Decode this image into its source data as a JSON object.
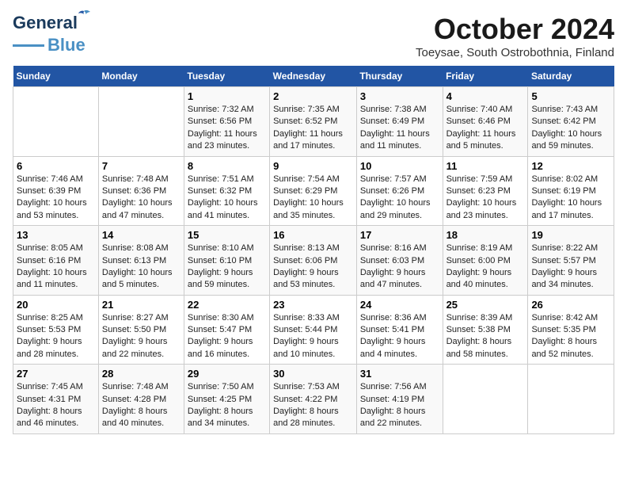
{
  "logo": {
    "line1": "General",
    "line2": "Blue"
  },
  "title": "October 2024",
  "subtitle": "Toeysae, South Ostrobothnia, Finland",
  "days_of_week": [
    "Sunday",
    "Monday",
    "Tuesday",
    "Wednesday",
    "Thursday",
    "Friday",
    "Saturday"
  ],
  "weeks": [
    [
      {
        "day": "",
        "content": ""
      },
      {
        "day": "",
        "content": ""
      },
      {
        "day": "1",
        "content": "Sunrise: 7:32 AM\nSunset: 6:56 PM\nDaylight: 11 hours\nand 23 minutes."
      },
      {
        "day": "2",
        "content": "Sunrise: 7:35 AM\nSunset: 6:52 PM\nDaylight: 11 hours\nand 17 minutes."
      },
      {
        "day": "3",
        "content": "Sunrise: 7:38 AM\nSunset: 6:49 PM\nDaylight: 11 hours\nand 11 minutes."
      },
      {
        "day": "4",
        "content": "Sunrise: 7:40 AM\nSunset: 6:46 PM\nDaylight: 11 hours\nand 5 minutes."
      },
      {
        "day": "5",
        "content": "Sunrise: 7:43 AM\nSunset: 6:42 PM\nDaylight: 10 hours\nand 59 minutes."
      }
    ],
    [
      {
        "day": "6",
        "content": "Sunrise: 7:46 AM\nSunset: 6:39 PM\nDaylight: 10 hours\nand 53 minutes."
      },
      {
        "day": "7",
        "content": "Sunrise: 7:48 AM\nSunset: 6:36 PM\nDaylight: 10 hours\nand 47 minutes."
      },
      {
        "day": "8",
        "content": "Sunrise: 7:51 AM\nSunset: 6:32 PM\nDaylight: 10 hours\nand 41 minutes."
      },
      {
        "day": "9",
        "content": "Sunrise: 7:54 AM\nSunset: 6:29 PM\nDaylight: 10 hours\nand 35 minutes."
      },
      {
        "day": "10",
        "content": "Sunrise: 7:57 AM\nSunset: 6:26 PM\nDaylight: 10 hours\nand 29 minutes."
      },
      {
        "day": "11",
        "content": "Sunrise: 7:59 AM\nSunset: 6:23 PM\nDaylight: 10 hours\nand 23 minutes."
      },
      {
        "day": "12",
        "content": "Sunrise: 8:02 AM\nSunset: 6:19 PM\nDaylight: 10 hours\nand 17 minutes."
      }
    ],
    [
      {
        "day": "13",
        "content": "Sunrise: 8:05 AM\nSunset: 6:16 PM\nDaylight: 10 hours\nand 11 minutes."
      },
      {
        "day": "14",
        "content": "Sunrise: 8:08 AM\nSunset: 6:13 PM\nDaylight: 10 hours\nand 5 minutes."
      },
      {
        "day": "15",
        "content": "Sunrise: 8:10 AM\nSunset: 6:10 PM\nDaylight: 9 hours\nand 59 minutes."
      },
      {
        "day": "16",
        "content": "Sunrise: 8:13 AM\nSunset: 6:06 PM\nDaylight: 9 hours\nand 53 minutes."
      },
      {
        "day": "17",
        "content": "Sunrise: 8:16 AM\nSunset: 6:03 PM\nDaylight: 9 hours\nand 47 minutes."
      },
      {
        "day": "18",
        "content": "Sunrise: 8:19 AM\nSunset: 6:00 PM\nDaylight: 9 hours\nand 40 minutes."
      },
      {
        "day": "19",
        "content": "Sunrise: 8:22 AM\nSunset: 5:57 PM\nDaylight: 9 hours\nand 34 minutes."
      }
    ],
    [
      {
        "day": "20",
        "content": "Sunrise: 8:25 AM\nSunset: 5:53 PM\nDaylight: 9 hours\nand 28 minutes."
      },
      {
        "day": "21",
        "content": "Sunrise: 8:27 AM\nSunset: 5:50 PM\nDaylight: 9 hours\nand 22 minutes."
      },
      {
        "day": "22",
        "content": "Sunrise: 8:30 AM\nSunset: 5:47 PM\nDaylight: 9 hours\nand 16 minutes."
      },
      {
        "day": "23",
        "content": "Sunrise: 8:33 AM\nSunset: 5:44 PM\nDaylight: 9 hours\nand 10 minutes."
      },
      {
        "day": "24",
        "content": "Sunrise: 8:36 AM\nSunset: 5:41 PM\nDaylight: 9 hours\nand 4 minutes."
      },
      {
        "day": "25",
        "content": "Sunrise: 8:39 AM\nSunset: 5:38 PM\nDaylight: 8 hours\nand 58 minutes."
      },
      {
        "day": "26",
        "content": "Sunrise: 8:42 AM\nSunset: 5:35 PM\nDaylight: 8 hours\nand 52 minutes."
      }
    ],
    [
      {
        "day": "27",
        "content": "Sunrise: 7:45 AM\nSunset: 4:31 PM\nDaylight: 8 hours\nand 46 minutes."
      },
      {
        "day": "28",
        "content": "Sunrise: 7:48 AM\nSunset: 4:28 PM\nDaylight: 8 hours\nand 40 minutes."
      },
      {
        "day": "29",
        "content": "Sunrise: 7:50 AM\nSunset: 4:25 PM\nDaylight: 8 hours\nand 34 minutes."
      },
      {
        "day": "30",
        "content": "Sunrise: 7:53 AM\nSunset: 4:22 PM\nDaylight: 8 hours\nand 28 minutes."
      },
      {
        "day": "31",
        "content": "Sunrise: 7:56 AM\nSunset: 4:19 PM\nDaylight: 8 hours\nand 22 minutes."
      },
      {
        "day": "",
        "content": ""
      },
      {
        "day": "",
        "content": ""
      }
    ]
  ]
}
